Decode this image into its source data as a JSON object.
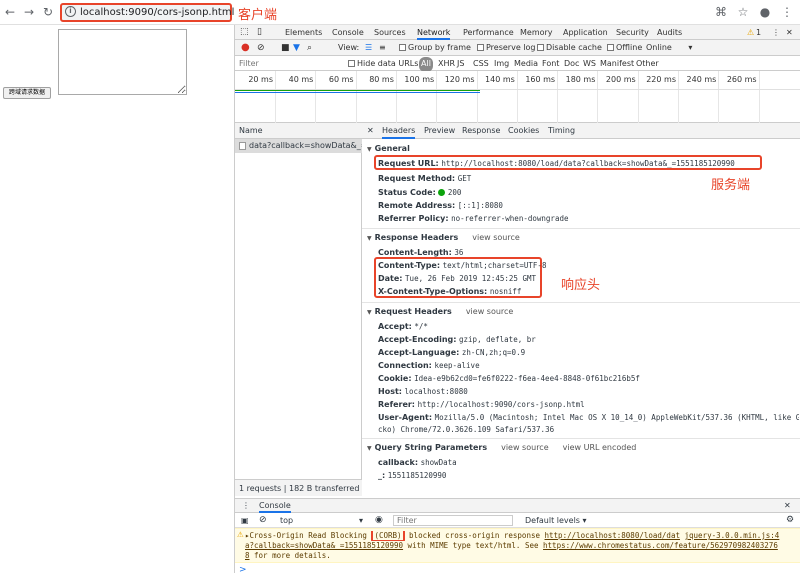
{
  "browser": {
    "url": "localhost:9090/cors-jsonp.html",
    "back_icon": "arrow-left-icon",
    "forward_icon": "arrow-right-icon",
    "reload_icon": "reload-icon"
  },
  "annotations": {
    "client": "客户端",
    "server": "服务端",
    "response_header": "响应头"
  },
  "page": {
    "button_label": "跨域请求数据"
  },
  "devtools": {
    "tabs": [
      "Elements",
      "Console",
      "Sources",
      "Network",
      "Performance",
      "Memory",
      "Application",
      "Security",
      "Audits"
    ],
    "active_tab": "Network",
    "warning_count": "1",
    "toolbar": {
      "view_label": "View:",
      "group_by_frame": "Group by frame",
      "preserve_log": "Preserve log",
      "disable_cache": "Disable cache",
      "offline": "Offline",
      "throttle": "Online"
    },
    "filter": {
      "placeholder": "Filter",
      "hide_data_urls": "Hide data URLs",
      "types": [
        "All",
        "XHR",
        "JS",
        "CSS",
        "Img",
        "Media",
        "Font",
        "Doc",
        "WS",
        "Manifest",
        "Other"
      ]
    },
    "timeline_ticks": [
      "20 ms",
      "40 ms",
      "60 ms",
      "80 ms",
      "100 ms",
      "120 ms",
      "140 ms",
      "160 ms",
      "180 ms",
      "200 ms",
      "220 ms",
      "240 ms",
      "260 ms"
    ],
    "names": {
      "header": "Name",
      "request": "data?callback=showData&_=...",
      "footer": "1 requests | 182 B transferred"
    },
    "detail_tabs": [
      "Headers",
      "Preview",
      "Response",
      "Cookies",
      "Timing"
    ],
    "active_detail_tab": "Headers",
    "general": {
      "title": "General",
      "request_url_k": "Request URL:",
      "request_url_v": "http://localhost:8080/load/data?callback=showData&_=1551185120990",
      "method_k": "Request Method:",
      "method_v": "GET",
      "status_k": "Status Code:",
      "status_v": "200",
      "remote_k": "Remote Address:",
      "remote_v": "[::1]:8080",
      "referrer_policy_k": "Referrer Policy:",
      "referrer_policy_v": "no-referrer-when-downgrade"
    },
    "response_headers": {
      "title": "Response Headers",
      "view_source": "view source",
      "content_length_k": "Content-Length:",
      "content_length_v": "36",
      "content_type_k": "Content-Type:",
      "content_type_v": "text/html;charset=UTF-8",
      "date_k": "Date:",
      "date_v": "Tue, 26 Feb 2019 12:45:25 GMT",
      "xcto_k": "X-Content-Type-Options:",
      "xcto_v": "nosniff"
    },
    "request_headers": {
      "title": "Request Headers",
      "view_source": "view source",
      "accept_k": "Accept:",
      "accept_v": "*/*",
      "encoding_k": "Accept-Encoding:",
      "encoding_v": "gzip, deflate, br",
      "language_k": "Accept-Language:",
      "language_v": "zh-CN,zh;q=0.9",
      "connection_k": "Connection:",
      "connection_v": "keep-alive",
      "cookie_k": "Cookie:",
      "cookie_v": "Idea-e9b62cd0=fe6f0222-f6ea-4ee4-8848-0f61bc216b5f",
      "host_k": "Host:",
      "host_v": "localhost:8080",
      "referer_k": "Referer:",
      "referer_v": "http://localhost:9090/cors-jsonp.html",
      "ua_k": "User-Agent:",
      "ua_v1": "Mozilla/5.0 (Macintosh; Intel Mac OS X 10_14_0) AppleWebKit/537.36 (KHTML, like Ge",
      "ua_v2": "cko) Chrome/72.0.3626.109 Safari/537.36"
    },
    "query": {
      "title": "Query String Parameters",
      "view_source": "view source",
      "view_url_encoded": "view URL encoded",
      "callback_k": "callback:",
      "callback_v": "showData",
      "underscore_k": "_:",
      "underscore_v": "1551185120990"
    },
    "console": {
      "tab": "Console",
      "context": "top",
      "filter_placeholder": "Filter",
      "levels": "Default levels ▾",
      "msg_1a": "▸Cross-Origin Read Blocking ",
      "msg_corb": "(CORB)",
      "msg_1b": " blocked cross-origin response ",
      "msg_link1a": "http://localhost:8080/load/dat",
      "msg_src": "jquery-3.0.0.min.js:4",
      "msg_link1b": "a?callback=showData&_=1551185120990",
      "msg_2": " with MIME type text/html. See ",
      "msg_link2a": "https://www.chromestatus.com/feature/562970982403276",
      "msg_link2b": "8",
      "msg_3": " for more details.",
      "prompt": ">"
    }
  }
}
